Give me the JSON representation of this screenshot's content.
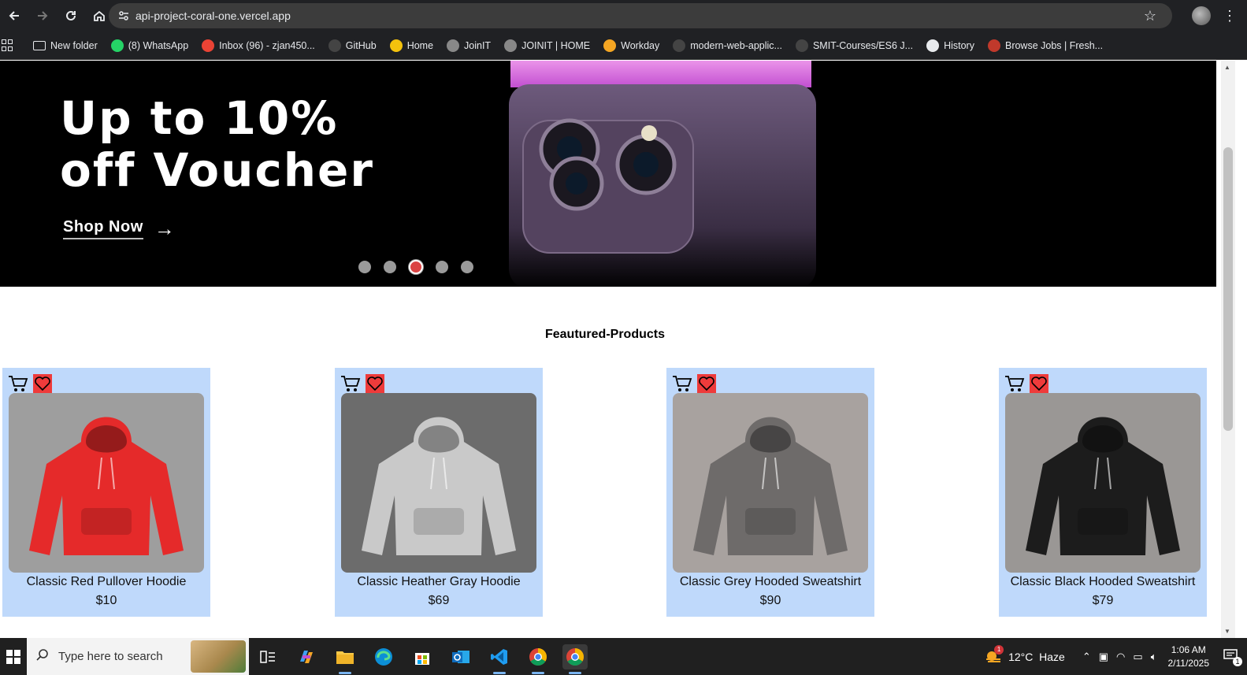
{
  "browser": {
    "url": "api-project-coral-one.vercel.app",
    "bookmarks": [
      {
        "label": "New folder",
        "icon": "folder-icon",
        "color": "#e8eaed"
      },
      {
        "label": "(8) WhatsApp",
        "icon": "whatsapp-icon",
        "color": "#25d366"
      },
      {
        "label": "Inbox (96) - zjan450...",
        "icon": "gmail-icon",
        "color": "#ea4335"
      },
      {
        "label": "GitHub",
        "icon": "github-icon",
        "color": "#444"
      },
      {
        "label": "Home",
        "icon": "home-bookmark-icon",
        "color": "#f4c20d"
      },
      {
        "label": "JoinIT",
        "icon": "joinit-icon",
        "color": "#888"
      },
      {
        "label": "JOINIT | HOME",
        "icon": "joinit-icon",
        "color": "#888"
      },
      {
        "label": "Workday",
        "icon": "workday-icon",
        "color": "#f5a623"
      },
      {
        "label": "modern-web-applic...",
        "icon": "github-icon",
        "color": "#444"
      },
      {
        "label": "SMIT-Courses/ES6 J...",
        "icon": "github-icon",
        "color": "#444"
      },
      {
        "label": "History",
        "icon": "history-icon",
        "color": "#e8eaed"
      },
      {
        "label": "Browse Jobs | Fresh...",
        "icon": "rozee-icon",
        "color": "#c0392b"
      }
    ]
  },
  "hero": {
    "title": "Up to 10%\noff Voucher",
    "cta_label": "Shop Now",
    "slides_total": 5,
    "active_slide": 3,
    "accent_color": "#db4444"
  },
  "featured": {
    "title": "Feautured-Products",
    "products": [
      {
        "name": "Classic Red Pullover Hoodie",
        "price": "$10",
        "hoodie_color": "#e52a2a",
        "bg": "#9e9e9e"
      },
      {
        "name": "Classic Heather Gray Hoodie",
        "price": "$69",
        "hoodie_color": "#c9c9c9",
        "bg": "#6c6c6c"
      },
      {
        "name": "Classic Grey Hooded Sweatshirt",
        "price": "$90",
        "hoodie_color": "#6e6b6a",
        "bg": "#a8a29f"
      },
      {
        "name": "Classic Black Hooded Sweatshirt",
        "price": "$79",
        "hoodie_color": "#1c1c1c",
        "bg": "#9a9795"
      }
    ],
    "card_color": "#bfd9fb"
  },
  "taskbar": {
    "search_placeholder": "Type here to search",
    "weather": "12°C  Haze",
    "weather_badge": "1",
    "time": "1:06 AM",
    "date": "2/11/2025",
    "notification_count": "1"
  }
}
